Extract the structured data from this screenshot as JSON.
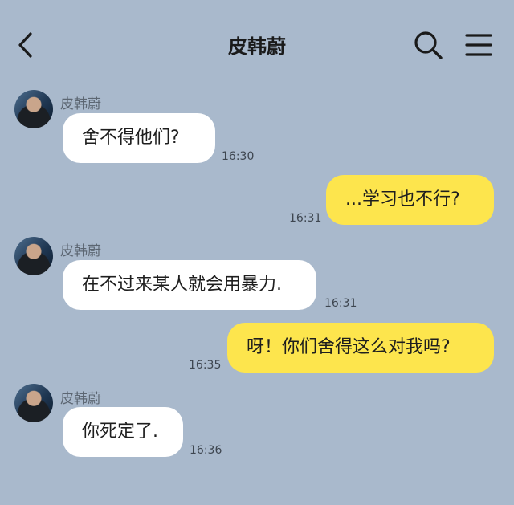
{
  "header": {
    "title": "皮韩蔚"
  },
  "icons": {
    "back": "back-arrow-icon",
    "search": "search-icon",
    "menu": "hamburger-menu-icon"
  },
  "colors": {
    "background": "#a9b9cc",
    "incoming_bubble": "#ffffff",
    "outgoing_bubble": "#fde54d"
  },
  "messages": [
    {
      "direction": "incoming",
      "sender": "皮韩蔚",
      "text": "舍不得他们?",
      "time": "16:30"
    },
    {
      "direction": "outgoing",
      "text": "...学习也不行?",
      "time": "16:31"
    },
    {
      "direction": "incoming",
      "sender": "皮韩蔚",
      "text": "在不过来某人就会用暴力.",
      "time": "16:31"
    },
    {
      "direction": "outgoing",
      "text": "呀！你们舍得这么对我吗?",
      "time": "16:35"
    },
    {
      "direction": "incoming",
      "sender": "皮韩蔚",
      "text": "你死定了.",
      "time": "16:36"
    }
  ]
}
